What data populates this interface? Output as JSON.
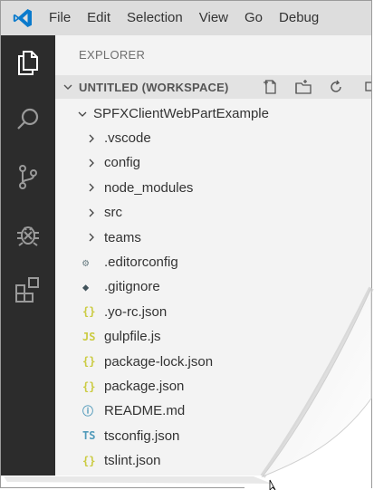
{
  "menu": {
    "items": [
      "File",
      "Edit",
      "Selection",
      "View",
      "Go",
      "Debug"
    ]
  },
  "activity_bar": {
    "icons": [
      "files-icon",
      "search-icon",
      "source-control-icon",
      "debug-icon",
      "extensions-icon"
    ]
  },
  "sidebar": {
    "header": "EXPLORER",
    "workspace_title": "UNTITLED (WORKSPACE)",
    "project": "SPFXClientWebPartExample",
    "folders": [
      ".vscode",
      "config",
      "node_modules",
      "src",
      "teams"
    ],
    "files": [
      {
        "name": ".editorconfig",
        "icon": "gear-icon",
        "glyph": "⚙",
        "color": "#6d8086"
      },
      {
        "name": ".gitignore",
        "icon": "git-icon",
        "glyph": "◆",
        "color": "#41535b"
      },
      {
        "name": ".yo-rc.json",
        "icon": "json-icon",
        "glyph": "{}",
        "color": "#cbcb41"
      },
      {
        "name": "gulpfile.js",
        "icon": "js-icon",
        "glyph": "JS",
        "color": "#cbcb41"
      },
      {
        "name": "package-lock.json",
        "icon": "json-icon",
        "glyph": "{}",
        "color": "#cbcb41"
      },
      {
        "name": "package.json",
        "icon": "json-icon",
        "glyph": "{}",
        "color": "#cbcb41"
      },
      {
        "name": "README.md",
        "icon": "info-icon",
        "glyph": "ⓘ",
        "color": "#519aba"
      },
      {
        "name": "tsconfig.json",
        "icon": "ts-icon",
        "glyph": "TS",
        "color": "#519aba"
      },
      {
        "name": "tslint.json",
        "icon": "json-icon",
        "glyph": "{}",
        "color": "#cbcb41"
      }
    ]
  },
  "colors": {
    "menubar": "#dddddd",
    "activity_bar": "#2c2c2c",
    "sidebar": "#f3f3f3",
    "accent": "#007acc"
  }
}
